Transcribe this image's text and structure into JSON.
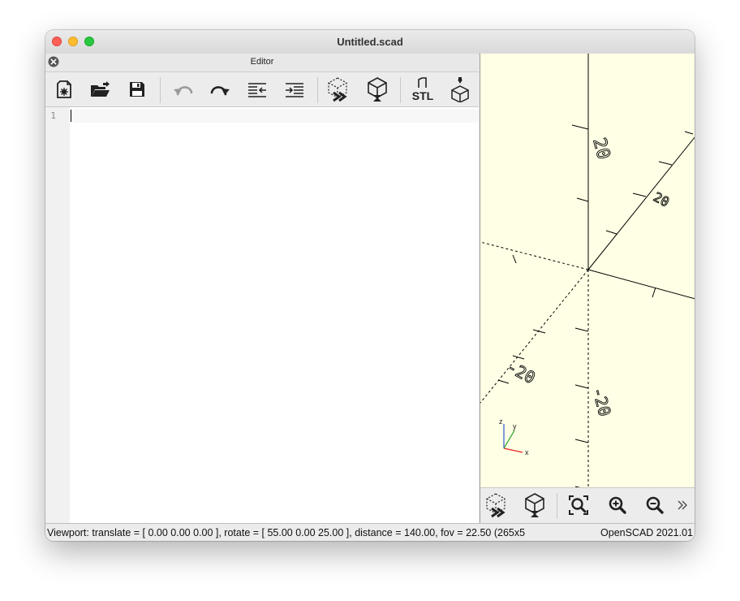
{
  "window": {
    "title": "Untitled.scad"
  },
  "editor": {
    "panel_title": "Editor",
    "lines": [
      "1"
    ]
  },
  "toolbar": {
    "items": [
      {
        "name": "new-file-icon"
      },
      {
        "name": "open-folder-icon"
      },
      {
        "name": "save-icon"
      },
      {
        "name": "undo-icon"
      },
      {
        "name": "redo-icon"
      },
      {
        "name": "unindent-icon"
      },
      {
        "name": "indent-icon"
      },
      {
        "name": "preview-icon"
      },
      {
        "name": "render-icon"
      },
      {
        "name": "export-stl-icon",
        "label": "STL"
      },
      {
        "name": "send-to-print-icon"
      }
    ]
  },
  "viewport": {
    "axis_labels": [
      "20",
      "20",
      "-20",
      "-20"
    ],
    "axes_indicator": {
      "x": "x",
      "y": "y",
      "z": "z"
    }
  },
  "view_toolbar": {
    "items": [
      {
        "name": "preview-icon"
      },
      {
        "name": "render-icon"
      },
      {
        "name": "view-all-icon"
      },
      {
        "name": "zoom-in-icon"
      },
      {
        "name": "zoom-out-icon"
      },
      {
        "name": "more-icon"
      }
    ]
  },
  "status": {
    "viewport": "Viewport: translate = [ 0.00 0.00 0.00 ], rotate = [ 55.00 0.00 25.00 ], distance = 140.00, fov = 22.50 (265x5",
    "version": "OpenSCAD 2021.01"
  }
}
